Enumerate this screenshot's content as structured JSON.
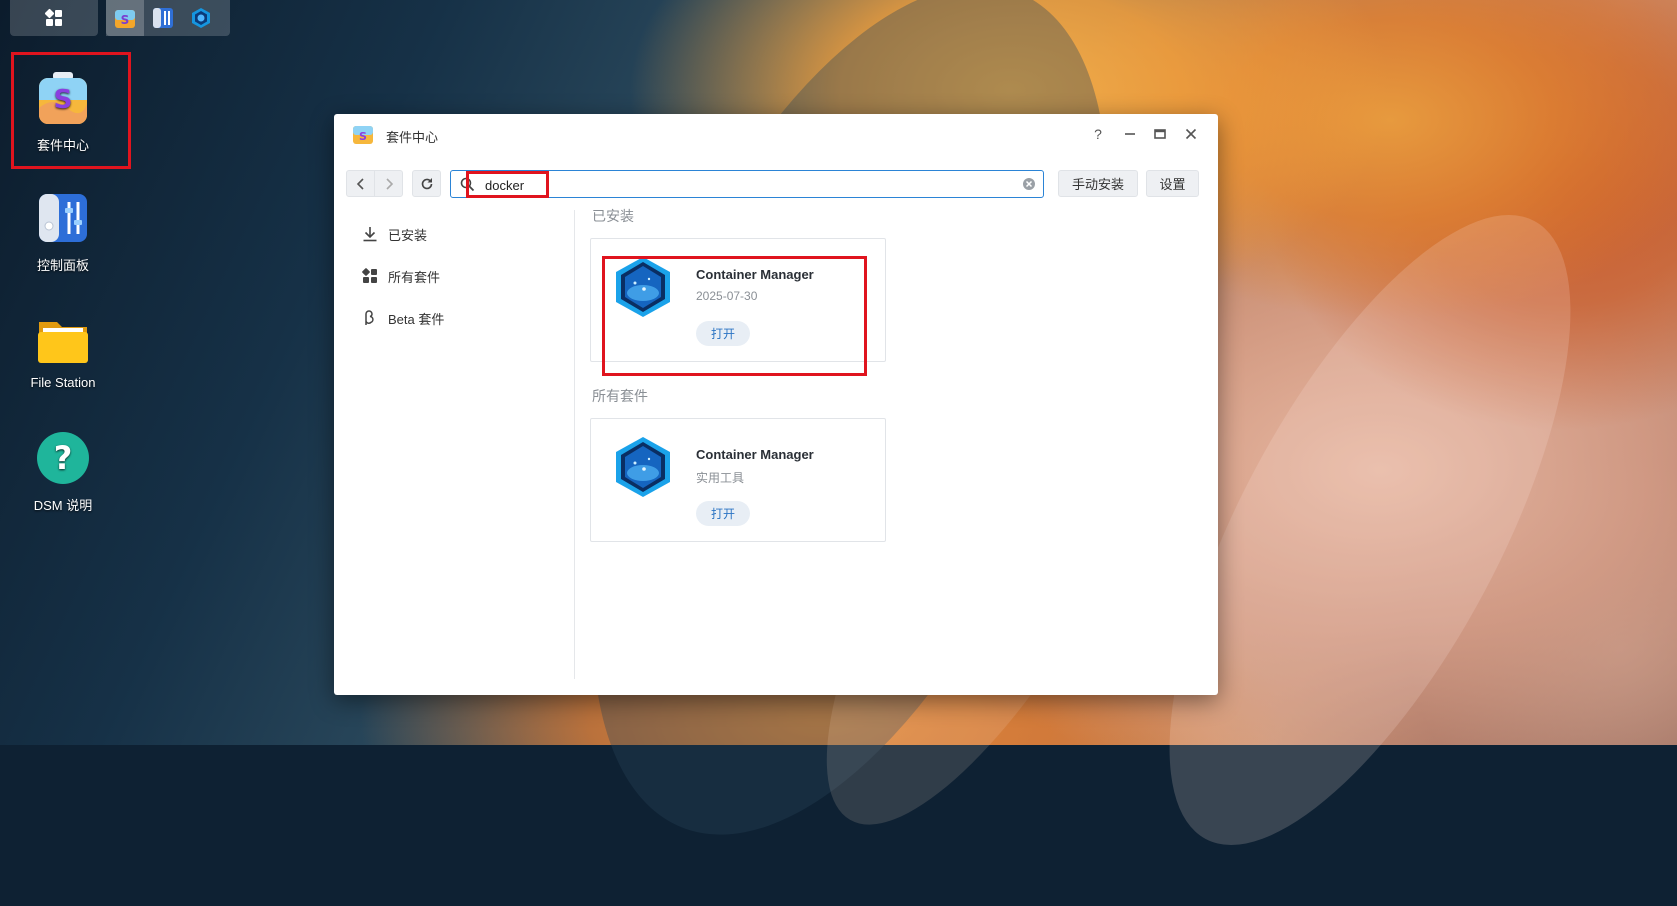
{
  "desktop": {
    "icons": [
      {
        "label": "套件中心"
      },
      {
        "label": "控制面板"
      },
      {
        "label": "File Station"
      },
      {
        "label": "DSM 说明"
      }
    ]
  },
  "window": {
    "title": "套件中心",
    "controls": {
      "help": "?"
    },
    "toolbar": {
      "search_value": "docker",
      "manual_install": "手动安装",
      "settings": "设置"
    },
    "sidebar": {
      "items": [
        {
          "label": "已安装",
          "icon": "download-icon"
        },
        {
          "label": "所有套件",
          "icon": "grid-icon"
        },
        {
          "label": "Beta 套件",
          "icon": "beta-icon"
        }
      ]
    },
    "sections": [
      {
        "title": "已安装",
        "cards": [
          {
            "name": "Container Manager",
            "sub": "2025-07-30",
            "action": "打开"
          }
        ]
      },
      {
        "title": "所有套件",
        "cards": [
          {
            "name": "Container Manager",
            "sub": "实用工具",
            "action": "打开"
          }
        ]
      }
    ]
  },
  "colors": {
    "accent": "#2b84d6",
    "highlight": "#e0141e",
    "open_button_text": "#2b74c4"
  }
}
